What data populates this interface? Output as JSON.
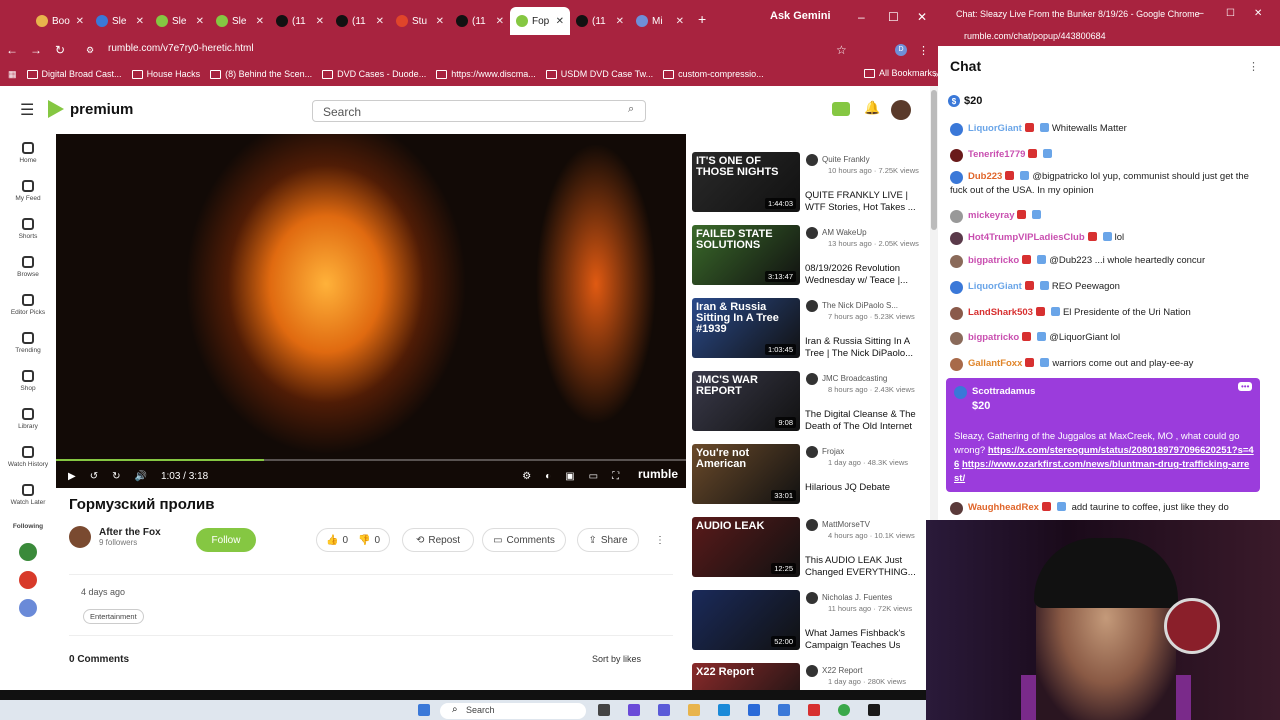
{
  "browser": {
    "tabs": [
      {
        "label": "Boo",
        "color": "#e8b44c"
      },
      {
        "label": "Sle",
        "color": "#3a78d8"
      },
      {
        "label": "Sle",
        "color": "#85c742"
      },
      {
        "label": "Sle",
        "color": "#85c742"
      },
      {
        "label": "(11",
        "color": "#111111"
      },
      {
        "label": "(11",
        "color": "#111111"
      },
      {
        "label": "Stu",
        "color": "#e0452a"
      },
      {
        "label": "(11",
        "color": "#111111"
      },
      {
        "label": "Fop",
        "color": "#85c742"
      },
      {
        "label": "(11",
        "color": "#111111"
      },
      {
        "label": "Mi",
        "color": "#6f8fd8"
      }
    ],
    "ask_gemini": "Ask Gemini",
    "url": "rumble.com/v7e7ry0-heretic.html",
    "bookmarks": [
      "Digital Broad Cast...",
      "House Hacks",
      "(8) Behind the Scen...",
      "DVD Cases - Duode...",
      "https://www.discma...",
      "USDM DVD Case Tw...",
      "custom-compressio..."
    ],
    "all_bookmarks": "All Bookmarks"
  },
  "site": {
    "logo": "premium",
    "search_placeholder": "Search",
    "accent": "#85c742",
    "nav": [
      "Home",
      "My Feed",
      "Shorts",
      "Browse",
      "Editor Picks",
      "Trending",
      "Shop",
      "Library",
      "Watch History",
      "Watch Later"
    ],
    "following_label": "Following"
  },
  "video": {
    "time": "1:03 / 3:18",
    "progress": 0.33,
    "brand": "rumble",
    "title": "Гормузский пролив",
    "channel": "After the Fox",
    "followers": "9 followers",
    "follow_label": "Follow",
    "likes": "0",
    "dislikes": "0",
    "repost": "Repost",
    "comments_btn": "Comments",
    "share": "Share",
    "posted": "4 days ago",
    "category": "Entertainment",
    "comment_count": "0 Comments",
    "sort": "Sort by likes"
  },
  "recommended": [
    {
      "channel": "Quite Frankly",
      "stats": "10 hours ago · 7.25K views",
      "title": "QUITE FRANKLY LIVE | WTF Stories, Hot Takes ...",
      "duration": "1:44:03",
      "thumb_text": "IT'S ONE OF THOSE NIGHTS",
      "thumb_color": "#2a2a2a"
    },
    {
      "channel": "AM WakeUp",
      "stats": "13 hours ago · 2.05K views",
      "title": "08/19/2026 Revolution Wednesday w/ Teace |...",
      "duration": "3:13:47",
      "thumb_text": "FAILED STATE SOLUTIONS",
      "thumb_color": "#3a6a2a"
    },
    {
      "channel": "The Nick DiPaolo S...",
      "stats": "7 hours ago · 5.23K views",
      "title": "Iran & Russia Sitting In A Tree | The Nick DiPaolo...",
      "duration": "1:03:45",
      "thumb_text": "Iran & Russia Sitting In A Tree #1939",
      "thumb_color": "#2a4a8a"
    },
    {
      "channel": "JMC Broadcasting",
      "stats": "8 hours ago · 2.43K views",
      "title": "The Digital Cleanse & The Death of The Old Internet",
      "duration": "9:08",
      "thumb_text": "JMC'S WAR REPORT",
      "thumb_color": "#3a3a4a"
    },
    {
      "channel": "Frojax",
      "stats": "1 day ago · 48.3K views",
      "title": "Hilarious JQ Debate",
      "duration": "33:01",
      "thumb_text": "You're not American",
      "thumb_color": "#6a4a2a"
    },
    {
      "channel": "MattMorseTV",
      "stats": "4 hours ago · 10.1K views",
      "title": "This AUDIO LEAK Just Changed EVERYTHING...",
      "duration": "12:25",
      "thumb_text": "AUDIO LEAK",
      "thumb_color": "#5a1a1a"
    },
    {
      "channel": "Nicholas J. Fuentes",
      "stats": "11 hours ago · 72K views",
      "title": "What James Fishback's Campaign Teaches Us",
      "duration": "52:00",
      "thumb_text": "",
      "thumb_color": "#1a2a5a"
    },
    {
      "channel": "X22 Report",
      "stats": "1 day ago · 280K views",
      "title": "",
      "duration": "",
      "thumb_text": "X22 Report",
      "thumb_color": "#8a2a2a"
    }
  ],
  "chat": {
    "window_title": "Chat: Sleazy Live From the Bunker 8/19/26 - Google Chrome",
    "url": "rumble.com/chat/popup/443800684",
    "heading": "Chat",
    "pinned_rant": "$20",
    "messages": [
      {
        "user": "LiquorGiant",
        "text": "Whitewalls Matter",
        "color": "#6aa5e8",
        "avatar": "#3a78d8"
      },
      {
        "user": "Tenerife1779",
        "text": "",
        "color": "#c94fb0",
        "avatar": "#6a1a1a"
      },
      {
        "user": "Dub223",
        "text": "@bigpatricko lol yup, communist should just get the fuck out of the USA. In my opinion",
        "color": "#e0652a",
        "avatar": "#3a78d8"
      },
      {
        "user": "mickeyray",
        "text": "",
        "color": "#c94fb0",
        "avatar": "#999999"
      },
      {
        "user": "Hot4TrumpVIPLadiesClub",
        "text": "lol",
        "color": "#c94fb0",
        "avatar": "#5a3a4a"
      },
      {
        "user": "bigpatricko",
        "text": "@Dub223 ...i whole heartedly concur",
        "color": "#c94fb0",
        "avatar": "#8a6a5a"
      },
      {
        "user": "LiquorGiant",
        "text": "REO Peewagon",
        "color": "#6aa5e8",
        "avatar": "#3a78d8"
      },
      {
        "user": "LandShark503",
        "text": "El Presidente of the Uri Nation",
        "color": "#d73030",
        "avatar": "#8a5a4a"
      },
      {
        "user": "bigpatricko",
        "text": "@LiquorGiant lol",
        "color": "#c94fb0",
        "avatar": "#8a6a5a"
      },
      {
        "user": "GallantFoxx",
        "text": "warriors come out and play-ee-ay",
        "color": "#e0852a",
        "avatar": "#a86a4a"
      }
    ],
    "highlight": {
      "user": "Scottradamus",
      "amount": "$20",
      "text": "Sleazy, Gathering of the Juggalos at MaxCreek, MO , what could go wrong?",
      "link1": "https://x.com/stereogum/status/2080189797096620251?s=46",
      "link2": "https://www.ozarkfirst.com/news/bluntman-drug-trafficking-arrest/"
    },
    "last_message": {
      "user": "WaughheadRex",
      "text": "add taurine to coffee, just like they do",
      "color": "#e0652a",
      "avatar": "#5a3a3a"
    }
  },
  "taskbar": {
    "search": "Search"
  }
}
